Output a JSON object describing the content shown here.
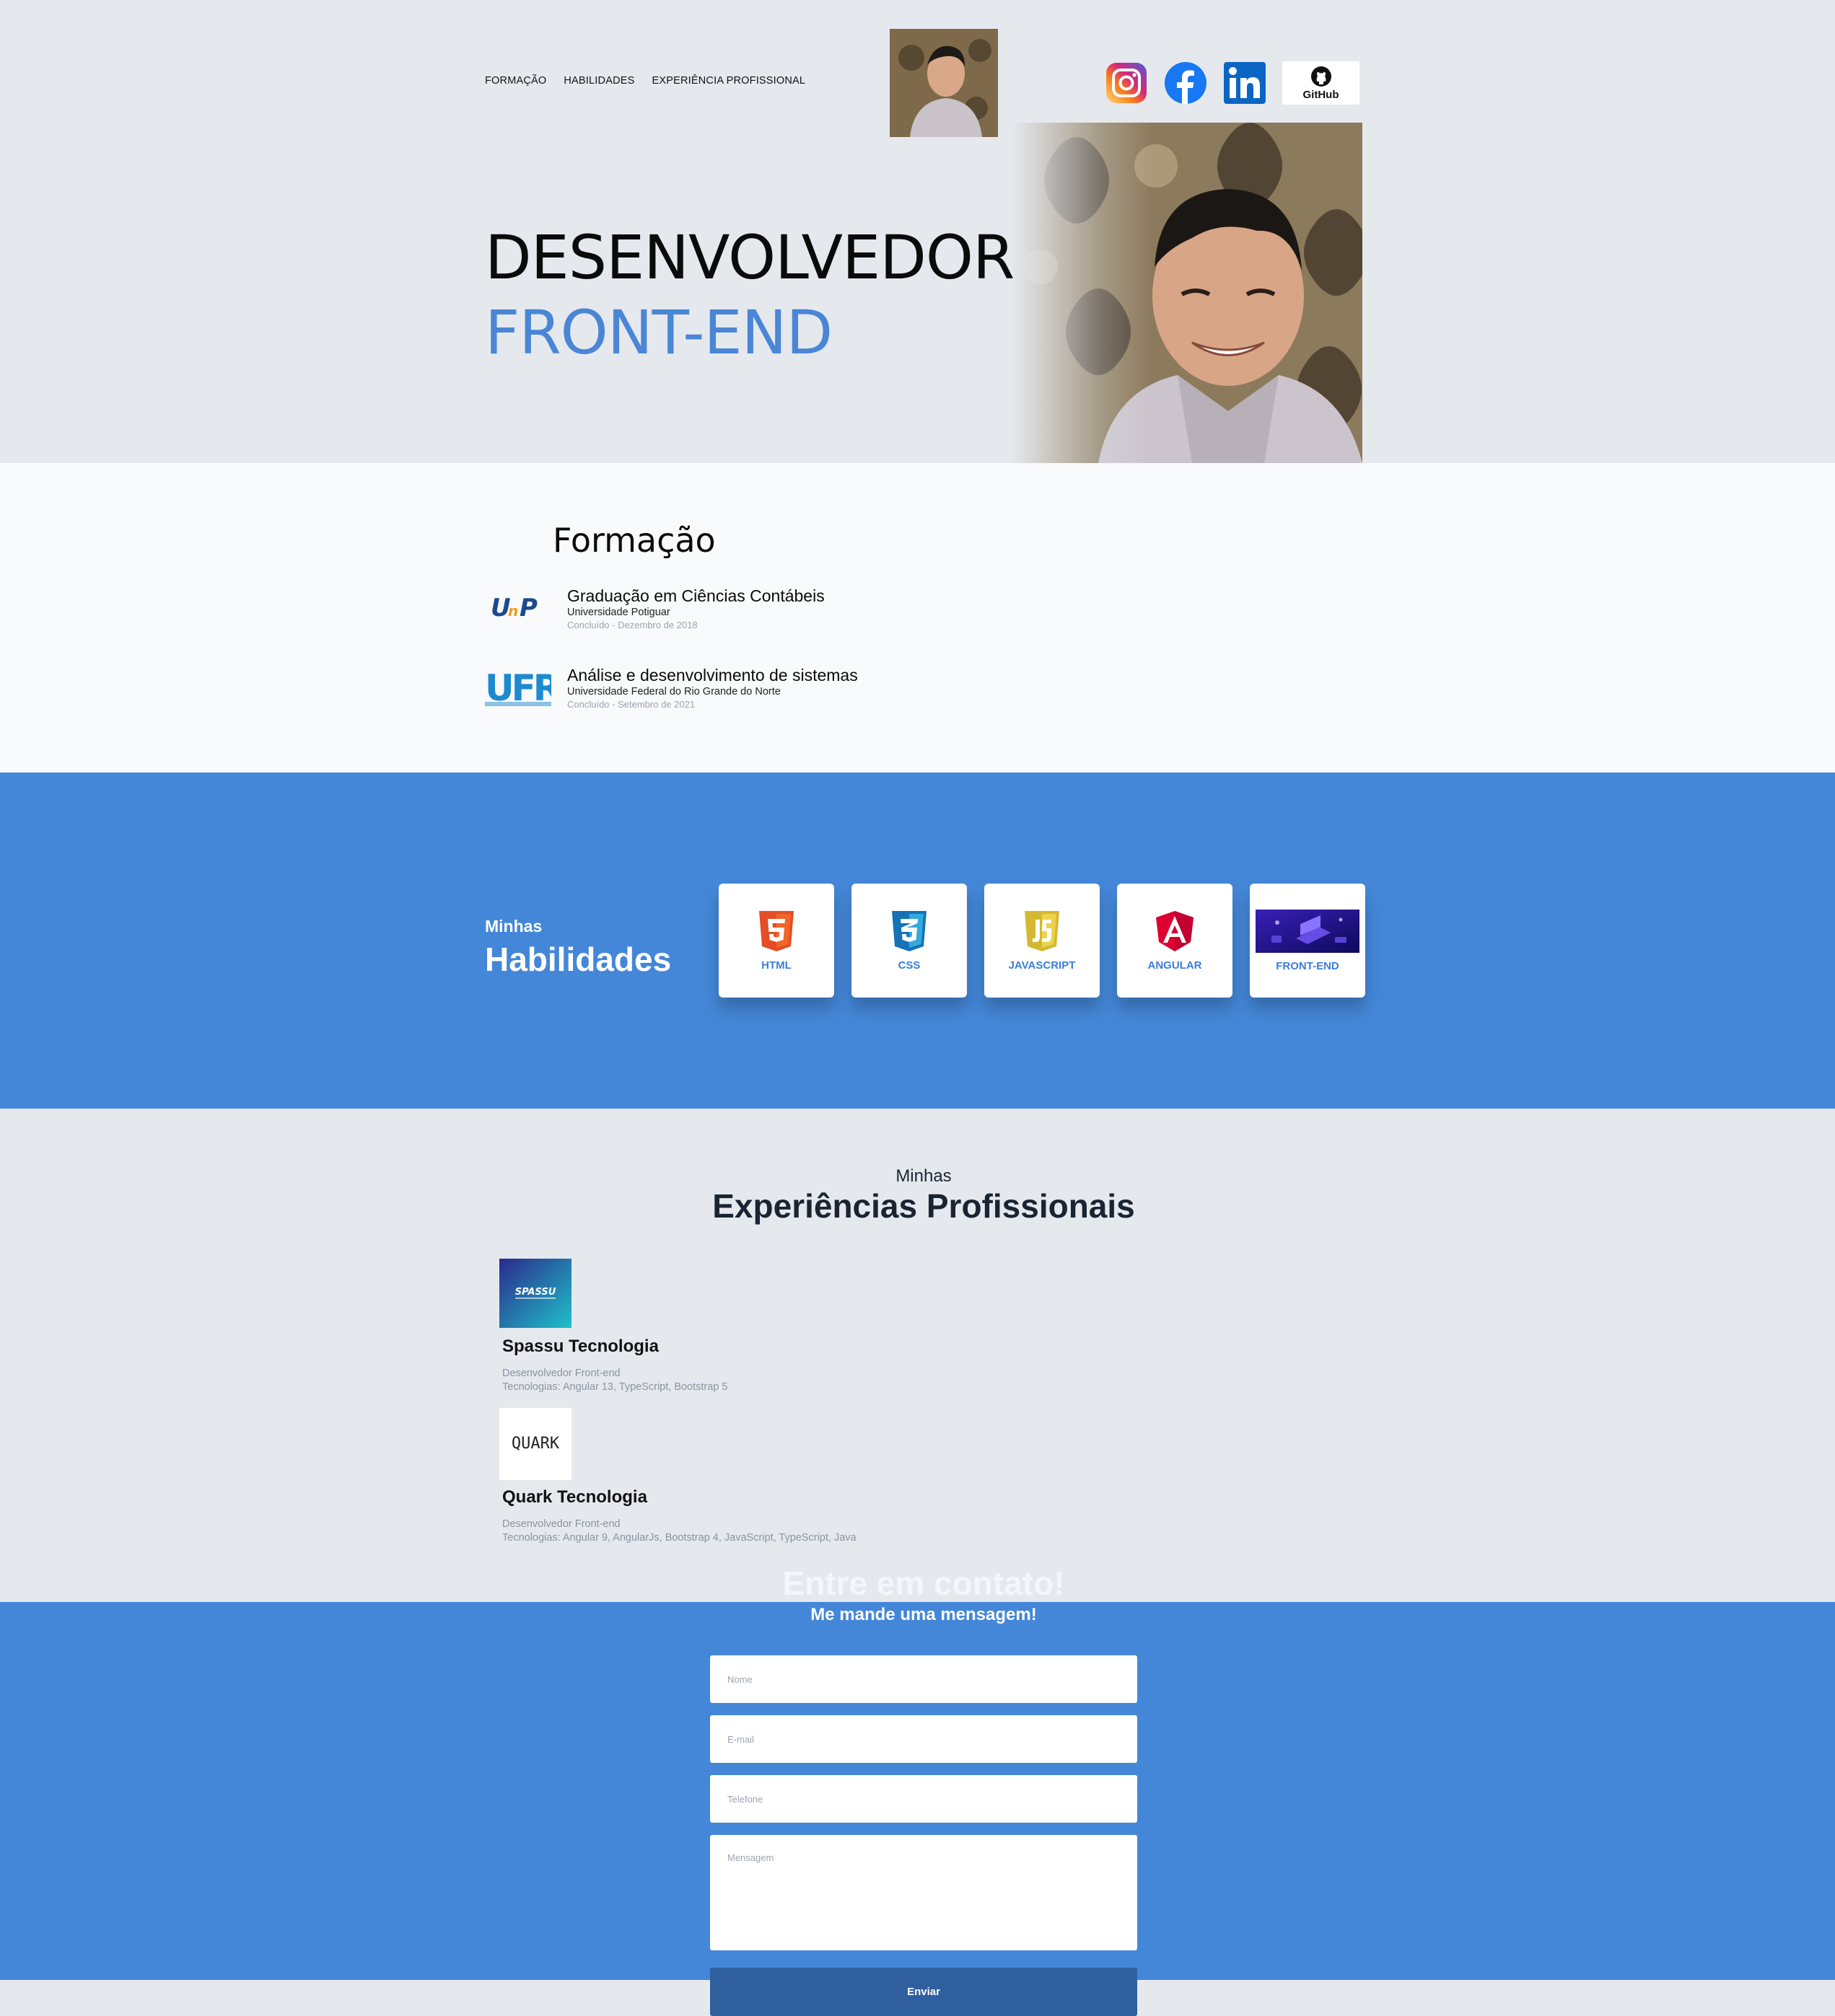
{
  "nav": {
    "items": [
      {
        "label": "FORMAÇÃO"
      },
      {
        "label": "HABILIDADES"
      },
      {
        "label": "EXPERIÊNCIA PROFISSIONAL"
      }
    ]
  },
  "social": {
    "github_label": "GitHub"
  },
  "hero": {
    "line1": "DESENVOLVEDOR",
    "line2": "FRONT-END",
    "accent": "#4a86d5"
  },
  "formacao": {
    "title": "Formação",
    "items": [
      {
        "logo": "UnP",
        "title": "Graduação em Ciências Contábeis",
        "school": "Universidade Potiguar",
        "date": "Concluído - Dezembro de 2018"
      },
      {
        "logo": "UFRN",
        "title": "Análise e desenvolvimento de sistemas",
        "school": "Universidade Federal do Rio Grande do Norte",
        "date": "Concluído - Setembro de 2021"
      }
    ]
  },
  "skills": {
    "subtitle": "Minhas",
    "title": "Habilidades",
    "bg": "#4487d8",
    "cards": [
      {
        "label": "HTML"
      },
      {
        "label": "CSS"
      },
      {
        "label": "JAVASCRIPT"
      },
      {
        "label": "ANGULAR"
      },
      {
        "label": "FRONT-END"
      }
    ]
  },
  "experience": {
    "subtitle": "Minhas",
    "title": "Experiências Profissionais",
    "jobs": [
      {
        "logo": "SPASSU",
        "company": "Spassu Tecnologia",
        "role": "Desenvolvedor Front-end",
        "tech": "Tecnologias: Angular 13, TypeScript, Bootstrap 5"
      },
      {
        "logo": "QUARK",
        "company": "Quark Tecnologia",
        "role": "Desenvolvedor Front-end",
        "tech": "Tecnologias: Angular 9, AngularJs, Bootstrap 4, JavaScript, TypeScript, Java"
      }
    ]
  },
  "contact": {
    "title": "Entre em contato!",
    "subtitle": "Me mande uma mensagem!",
    "name_placeholder": "Nome",
    "email_placeholder": "E-mail",
    "phone_placeholder": "Telefone",
    "message_placeholder": "Mensagem",
    "submit_label": "Enviar"
  }
}
